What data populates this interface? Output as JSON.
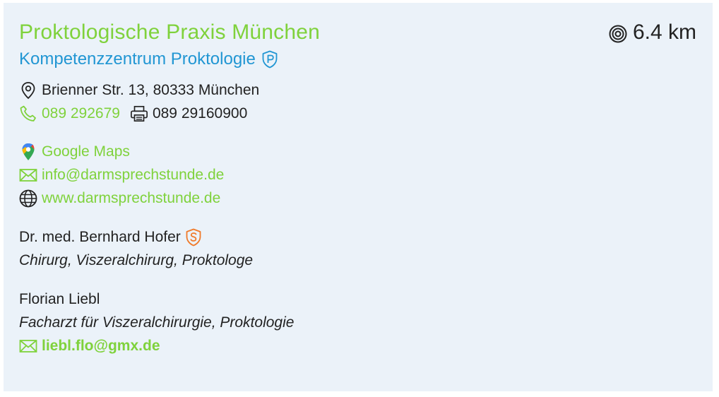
{
  "practice": {
    "name": "Proktologische Praxis München",
    "subtitle": "Kompetenzzentrum Proktologie",
    "distance": "6.4 km",
    "address": "Brienner Str. 13, 80333 München",
    "phone": "089 292679",
    "fax": "089 29160900",
    "maps_label": "Google Maps",
    "email": "info@darmsprechstunde.de",
    "website": "www.darmsprechstunde.de"
  },
  "people": [
    {
      "name": "Dr. med. Bernhard Hofer",
      "role": "Chirurg, Viszeralchirurg, Proktologe",
      "badge_icon": "s-shield-icon"
    },
    {
      "name": "Florian Liebl",
      "role": "Facharzt für Viszeralchirurgie, Proktologie",
      "email": "liebl.flo@gmx.de"
    }
  ],
  "colors": {
    "title": "#7fd23c",
    "subtitle": "#2196d3",
    "link": "#7fd23c",
    "badge_orange": "#f07a2a",
    "background": "#ebf2f9"
  },
  "icons": {
    "distance": "radar-icon",
    "subtitle_badge": "p-shield-icon",
    "address": "map-pin-icon",
    "phone": "phone-icon",
    "fax": "printer-icon",
    "maps": "google-maps-pin-icon",
    "email": "envelope-icon",
    "website": "globe-icon"
  }
}
